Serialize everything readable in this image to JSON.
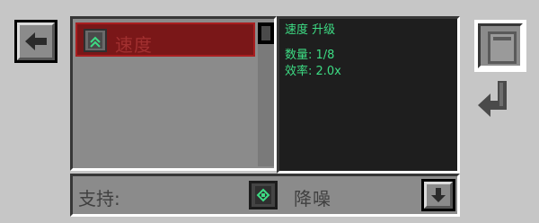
{
  "nav": {
    "back_icon": "arrow-left-icon"
  },
  "upgrade_list": {
    "items": [
      {
        "label": "速度",
        "icon": "speed-upgrade-icon",
        "selected": true
      }
    ],
    "scroll_position": 0
  },
  "info": {
    "title": "速度 升级",
    "quantity": "数量: 1/8",
    "efficiency": "效率: 2.0x"
  },
  "slot": {
    "icon": "upgrade-card-icon"
  },
  "return_icon": "return-arrow-icon",
  "supported": {
    "label": "支持:",
    "item_icon": "muffler-upgrade-icon",
    "item_name": "降噪",
    "next_icon": "arrow-down-icon"
  },
  "colors": {
    "background": "#c6c6c6",
    "selected_row": "#7a1718",
    "info_text": "#3ddc84",
    "info_bg": "#1e1e1e"
  }
}
